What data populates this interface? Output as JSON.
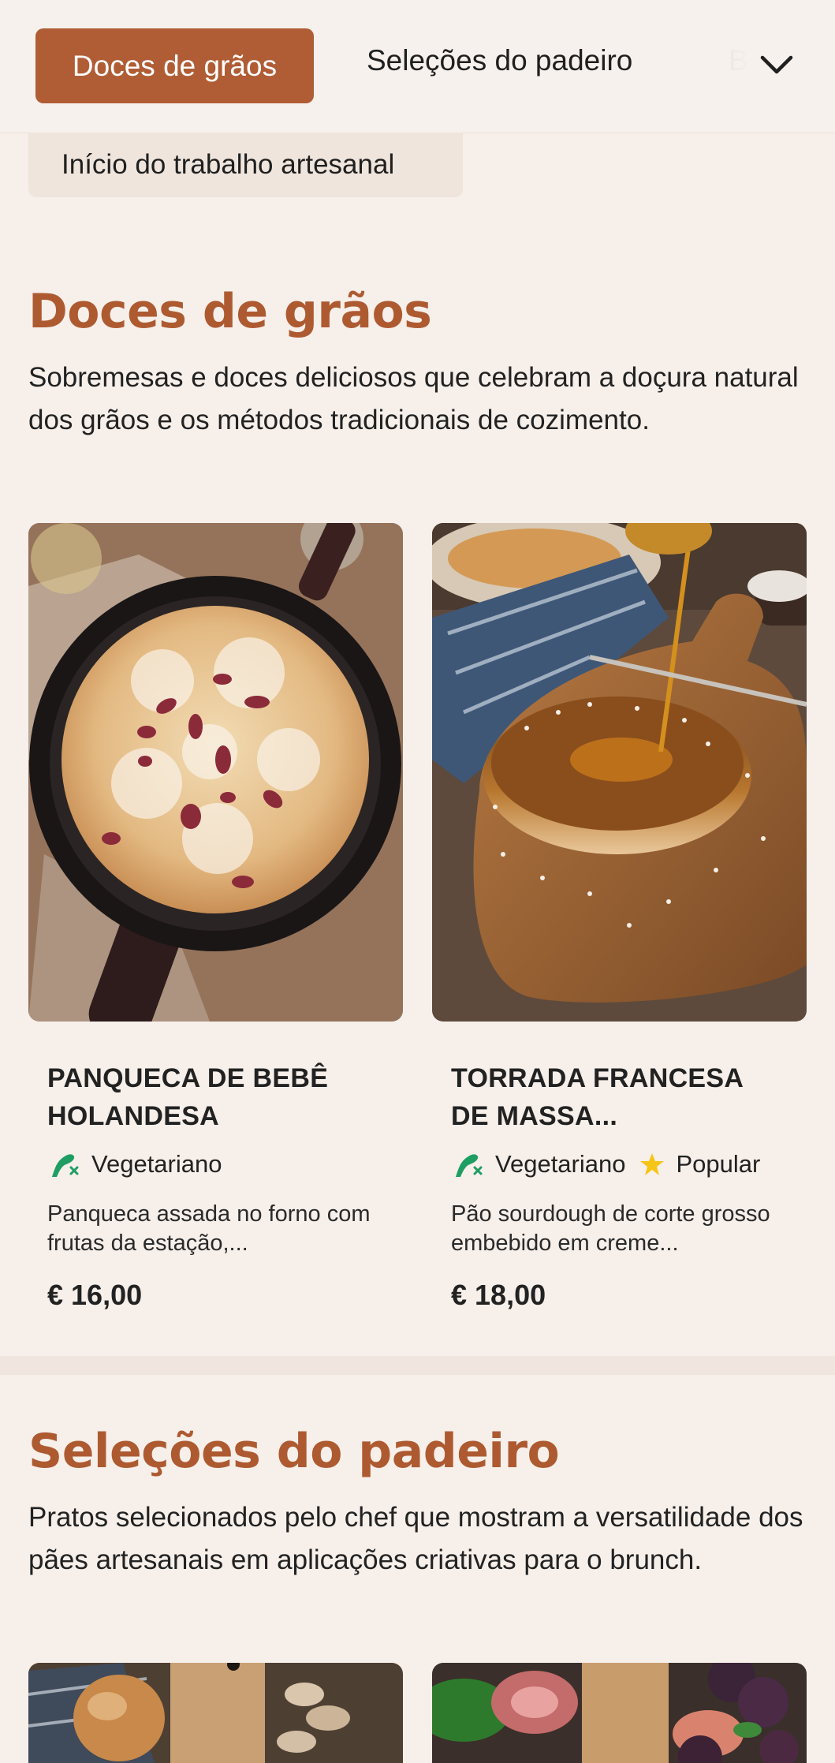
{
  "nav": {
    "tabs": [
      {
        "label": "Doces de grãos",
        "active": true
      },
      {
        "label": "Seleções do padeiro",
        "active": false
      },
      {
        "label": "B",
        "active": false
      }
    ],
    "expand_icon": "chevron-down-icon",
    "subcategory": "Início do trabalho artesanal"
  },
  "sections": [
    {
      "title": "Doces de grãos",
      "description": "Sobremesas e doces deliciosos que celebram a doçura natural dos grãos e os métodos tradicionais de cozimento.",
      "items": [
        {
          "name": "PANQUECA DE BEBÊ HOLANDESA",
          "tags": [
            {
              "label": "Vegetariano",
              "icon": "vegetarian-icon"
            }
          ],
          "description": "Panqueca assada no forno com frutas da estação,...",
          "price": "€ 16,00"
        },
        {
          "name": "TORRADA FRANCESA DE MASSA...",
          "tags": [
            {
              "label": "Vegetariano",
              "icon": "vegetarian-icon"
            },
            {
              "label": "Popular",
              "icon": "star-icon"
            }
          ],
          "description": "Pão sourdough de corte grosso embebido em creme...",
          "price": "€ 18,00"
        }
      ]
    },
    {
      "title": "Seleções do padeiro",
      "description": "Pratos selecionados pelo chef que mostram a versatilidade dos pães artesanais em aplicações criativas para o brunch."
    }
  ],
  "colors": {
    "accent": "#b05d35",
    "background": "#f6efea",
    "vegetarian_green": "#1e9e63",
    "star_yellow": "#f5c518"
  }
}
